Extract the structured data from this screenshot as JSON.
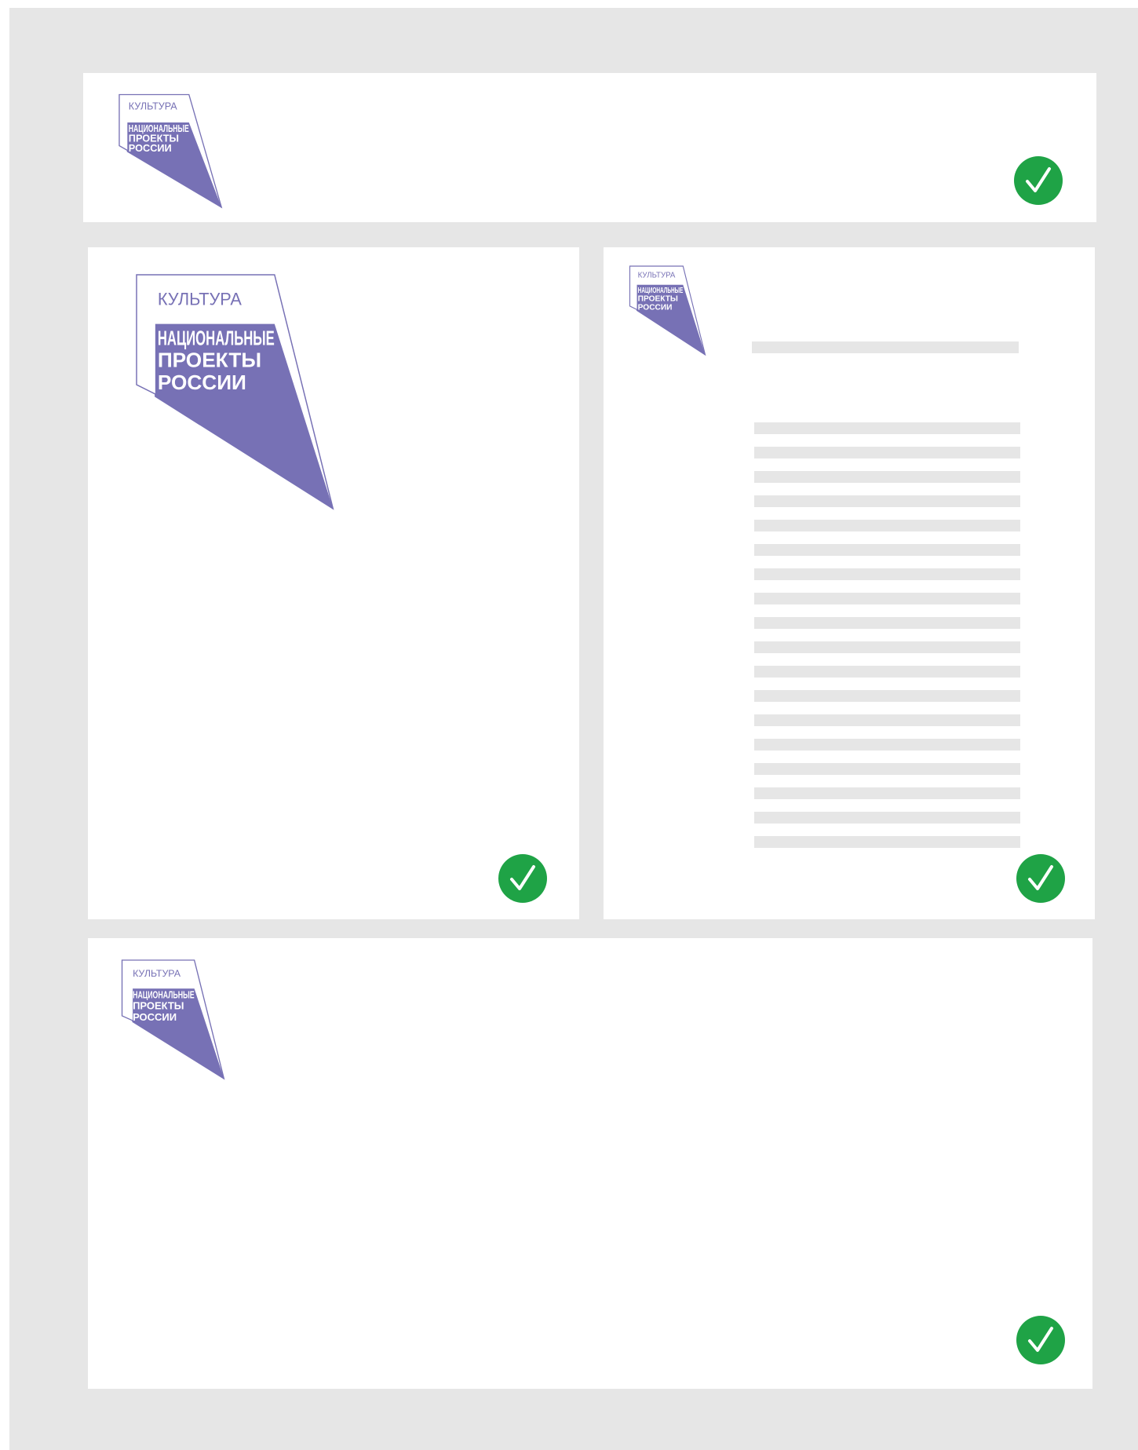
{
  "colors": {
    "background": "#e6e6e6",
    "card": "#ffffff",
    "logo_purple": "#7771b5",
    "check_green": "#1fa346",
    "placeholder_bar": "#e6e6e6"
  },
  "logo": {
    "line1": "КУЛЬТУРА",
    "line2": "НАЦИОНАЛЬНЫЕ",
    "line3": "ПРОЕКТЫ",
    "line4": "РОССИИ"
  },
  "icons": {
    "approved": "check-circle-icon"
  },
  "cards": [
    {
      "name": "banner-layout",
      "status": "approved"
    },
    {
      "name": "cover-layout",
      "status": "approved"
    },
    {
      "name": "text-page-layout",
      "status": "approved",
      "placeholder_lines": 18
    },
    {
      "name": "wide-layout",
      "status": "approved"
    }
  ]
}
